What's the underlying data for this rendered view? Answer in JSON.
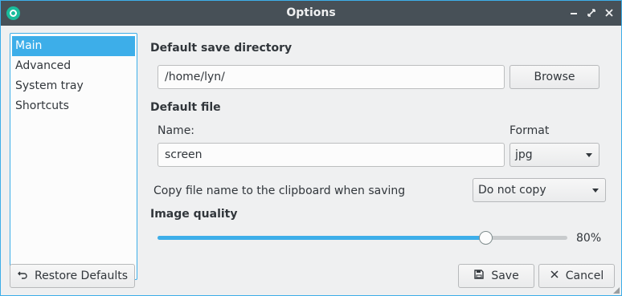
{
  "window": {
    "title": "Options",
    "accent_color": "#3daee9"
  },
  "sidebar": {
    "items": [
      {
        "label": "Main",
        "selected": true
      },
      {
        "label": "Advanced",
        "selected": false
      },
      {
        "label": "System tray",
        "selected": false
      },
      {
        "label": "Shortcuts",
        "selected": false
      }
    ]
  },
  "main": {
    "save_dir_heading": "Default save directory",
    "save_dir_value": "/home/lyn/",
    "browse_label": "Browse",
    "default_file_heading": "Default file",
    "name_label": "Name:",
    "name_value": "screen",
    "format_label": "Format",
    "format_value": "jpg",
    "clipboard_label": "Copy file name to the clipboard when saving",
    "clipboard_value": "Do not copy",
    "quality_heading": "Image quality",
    "quality_value": 80,
    "quality_text": "80%"
  },
  "footer": {
    "restore_label": "Restore Defaults",
    "save_label": "Save",
    "cancel_label": "Cancel"
  },
  "icons": {
    "app": "app-icon",
    "minimize": "minimize-icon",
    "restore": "restore-icon",
    "close": "close-icon",
    "undo": "undo-icon",
    "save": "floppy-disk-icon",
    "cancel": "x-icon",
    "dropdown": "chevron-down-icon"
  }
}
